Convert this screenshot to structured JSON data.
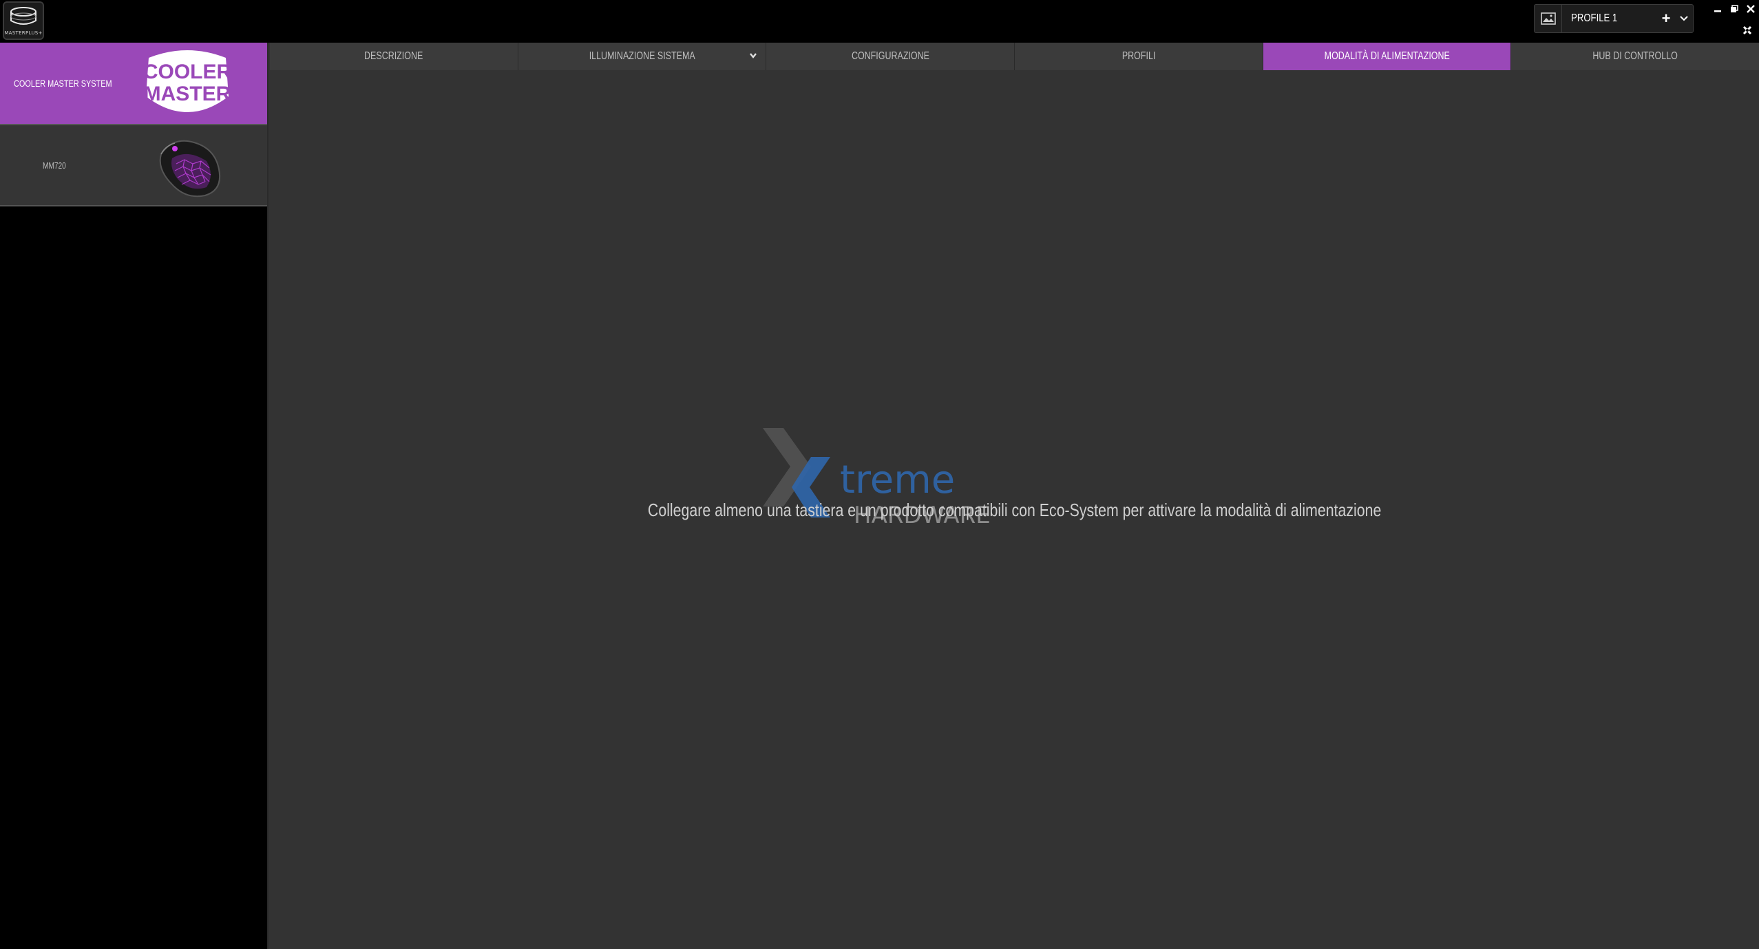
{
  "app": {
    "logo_label": "MASTERPLUS+"
  },
  "titlebar": {
    "profile_name": "PROFILE 1",
    "profile_add_symbol": "+",
    "icons": [
      "image-icon",
      "plus-icon",
      "chevron-down-icon",
      "minimize-icon",
      "restore-icon",
      "close-icon",
      "tools-icon"
    ]
  },
  "sidebar": {
    "devices": [
      {
        "name": "COOLER MASTER SYSTEM",
        "logo_text": [
          "COOLER",
          "MASTER"
        ],
        "active": true
      },
      {
        "name": "MM720",
        "active": false
      }
    ]
  },
  "tabs": [
    {
      "label": "DESCRIZIONE",
      "active": false
    },
    {
      "label": "ILLUMINAZIONE SISTEMA",
      "active": false,
      "has_dropdown": true
    },
    {
      "label": "CONFIGURAZIONE",
      "active": false
    },
    {
      "label": "PROFILI",
      "active": false
    },
    {
      "label": "MODALITÀ DI ALIMENTAZIONE",
      "active": true
    },
    {
      "label": "HUB DI CONTROLLO",
      "active": false
    }
  ],
  "main": {
    "message": "Collegare almeno una tastiera e un prodotto compatibili con Eco-System per attivare la modalità di alimentazione",
    "watermark": {
      "text_1": "treme",
      "text_2": "HARDWARE"
    }
  },
  "colors": {
    "accent": "#9a48b8",
    "background": "#333333",
    "titlebar": "#000000",
    "tab_bg": "#3b3b3b"
  }
}
